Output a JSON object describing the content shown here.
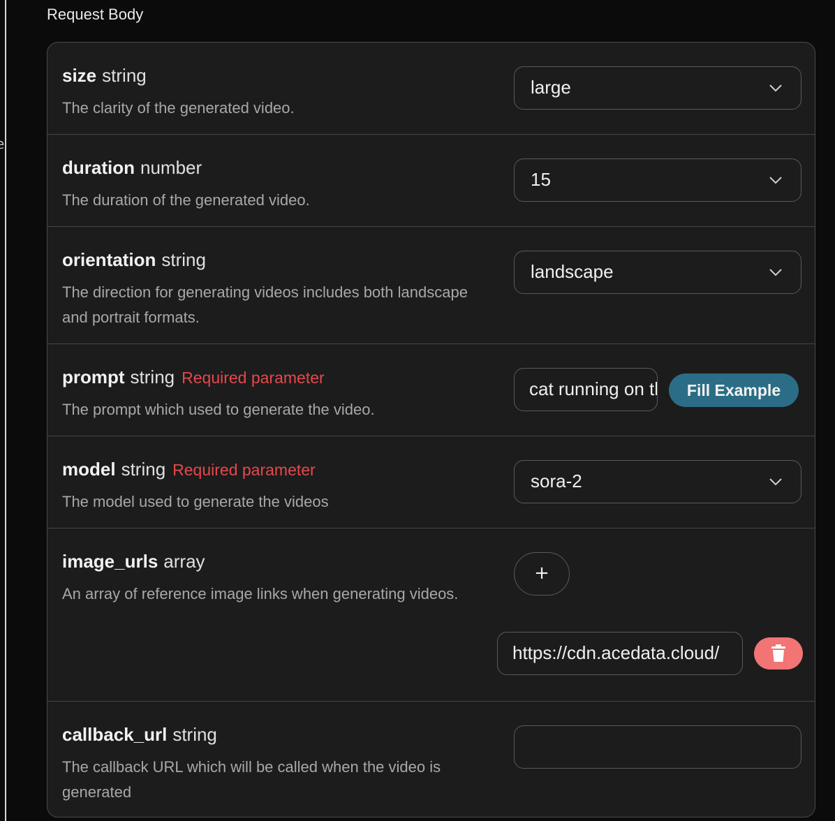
{
  "section_title": "Request Body",
  "params": [
    {
      "name": "size",
      "type": "string",
      "required": "",
      "description": "The clarity of the generated video.",
      "control": "select",
      "value": "large"
    },
    {
      "name": "duration",
      "type": "number",
      "required": "",
      "description": "The duration of the generated video.",
      "control": "select",
      "value": "15"
    },
    {
      "name": "orientation",
      "type": "string",
      "required": "",
      "description": "The direction for generating videos includes both landscape and portrait formats.",
      "control": "select",
      "value": "landscape"
    },
    {
      "name": "prompt",
      "type": "string",
      "required": "Required parameter",
      "description": "The prompt which used to generate the video.",
      "control": "text",
      "value": "cat running on the river",
      "button": "Fill Example"
    },
    {
      "name": "model",
      "type": "string",
      "required": "Required parameter",
      "description": "The model used to generate the videos",
      "control": "select",
      "value": "sora-2"
    },
    {
      "name": "image_urls",
      "type": "array",
      "required": "",
      "description": "An array of reference image links when generating videos.",
      "control": "array",
      "add_label": "+",
      "items": [
        "https://cdn.acedata.cloud/"
      ]
    },
    {
      "name": "callback_url",
      "type": "string",
      "required": "",
      "description": "The callback URL which will be called when the video is generated",
      "control": "text",
      "value": ""
    }
  ],
  "colors": {
    "background": "#0b0b0b",
    "card": "#1c1c1c",
    "required": "#e5484d",
    "fill_button": "#2b6d86",
    "delete_button": "#f27474"
  }
}
